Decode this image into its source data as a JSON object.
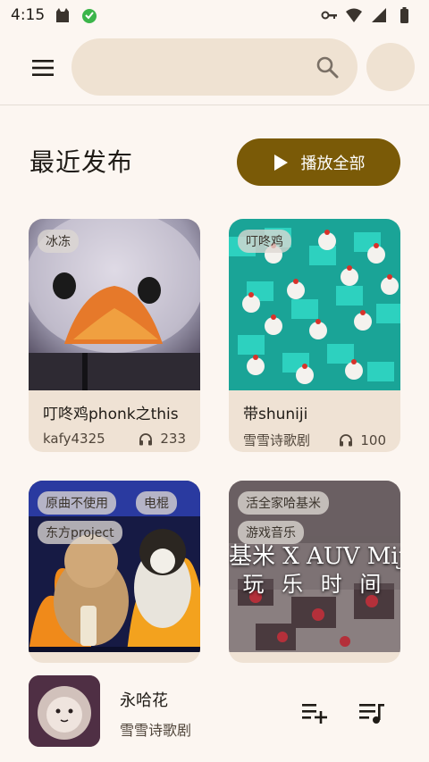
{
  "status_bar": {
    "time": "4:15"
  },
  "header": {
    "search_placeholder": ""
  },
  "section": {
    "title": "最近发布",
    "play_all_label": "播放全部"
  },
  "cards": [
    {
      "title": "叮咚鸡phonk之this",
      "artist": "kafy4325",
      "plays": "233",
      "tags": [
        "冰冻"
      ]
    },
    {
      "title": "带shuniji",
      "artist": "雪雪诗歌剧",
      "plays": "100",
      "tags": [
        "叮咚鸡"
      ]
    },
    {
      "title": "",
      "artist": "",
      "plays": "",
      "tags": [
        "原曲不使用",
        "电棍",
        "东方project"
      ]
    },
    {
      "title": "",
      "artist": "",
      "plays": "",
      "tags": [
        "活全家哈基米",
        "游戏音乐"
      ],
      "cover_text": [
        "基米 X AUV Mij",
        "玩 乐 时 间"
      ]
    }
  ],
  "player": {
    "title": "永哈花",
    "artist": "雪雪诗歌剧"
  },
  "colors": {
    "accent": "#7a5a07",
    "surface": "#efe2d2",
    "background": "#fcf6f1"
  }
}
